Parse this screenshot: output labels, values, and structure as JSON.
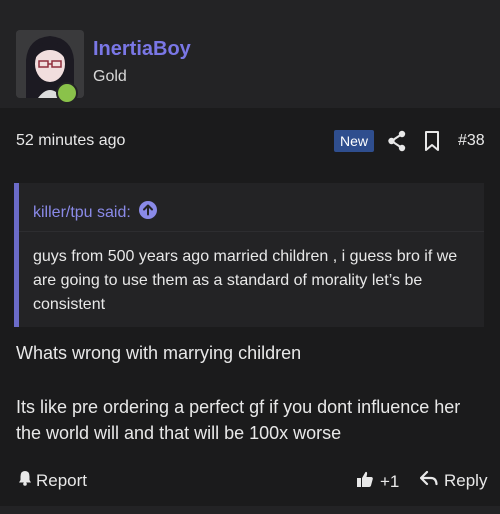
{
  "post": {
    "username": "InertiaBoy",
    "user_title": "Gold",
    "timestamp": "52 minutes ago",
    "new_badge": "New",
    "post_number": "#38"
  },
  "quote": {
    "author": "killer/tpu said:",
    "text": "guys from 500 years ago married children , i guess bro if we are going to use them as a standard of morality let’s be consistent"
  },
  "body": {
    "line1": "Whats wrong with marrying children",
    "line2": "Its like pre ordering a perfect gf if you dont influence her the world will and that will be 100x worse"
  },
  "actions": {
    "report_label": "Report",
    "like_count": "+1",
    "reply_label": "Reply"
  },
  "colors": {
    "username": "#7a77e6",
    "quote_accent": "#6b6bc8",
    "new_badge_bg": "#2f4e8e",
    "online_dot": "#8ac24a"
  },
  "icons": [
    "avatar-image",
    "online-status-dot",
    "share-icon",
    "bookmark-icon",
    "arrow-up-circle-icon",
    "bell-icon",
    "thumbs-up-icon",
    "reply-arrow-icon"
  ]
}
